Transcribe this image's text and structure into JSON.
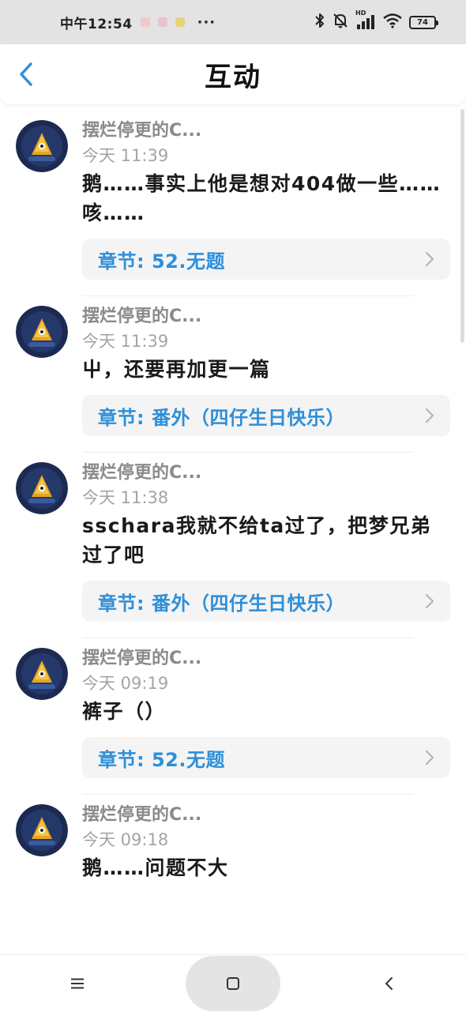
{
  "status_bar": {
    "time": "中午12:54",
    "more": "···",
    "network_badge": "HD",
    "battery": "74"
  },
  "header": {
    "title": "互动"
  },
  "comments": [
    {
      "author": "摆烂停更的C...",
      "time": "今天 11:39",
      "text": "鹅……事实上他是想对404做一些……咳……",
      "chapter": "章节: 52.无题"
    },
    {
      "author": "摆烂停更的C...",
      "time": "今天 11:39",
      "text": "屮，还要再加更一篇",
      "chapter": "章节: 番外（四仔生日快乐）"
    },
    {
      "author": "摆烂停更的C...",
      "time": "今天 11:38",
      "text": "sschara我就不给ta过了，把梦兄弟过了吧",
      "chapter": "章节: 番外（四仔生日快乐）"
    },
    {
      "author": "摆烂停更的C...",
      "time": "今天 09:19",
      "text": "裤子（）",
      "chapter": "章节: 52.无题"
    },
    {
      "author": "摆烂停更的C...",
      "time": "今天 09:18",
      "text": "鹅……问题不大"
    }
  ],
  "colors": {
    "accent": "#2e8fd9",
    "status_bar_bg": "#e3e3e3"
  },
  "icons": {
    "back": "chevron-left-icon",
    "card_arrow": "chevron-right-icon",
    "nav_menu": "menu-icon",
    "nav_home": "square-icon",
    "nav_back": "back-icon"
  }
}
